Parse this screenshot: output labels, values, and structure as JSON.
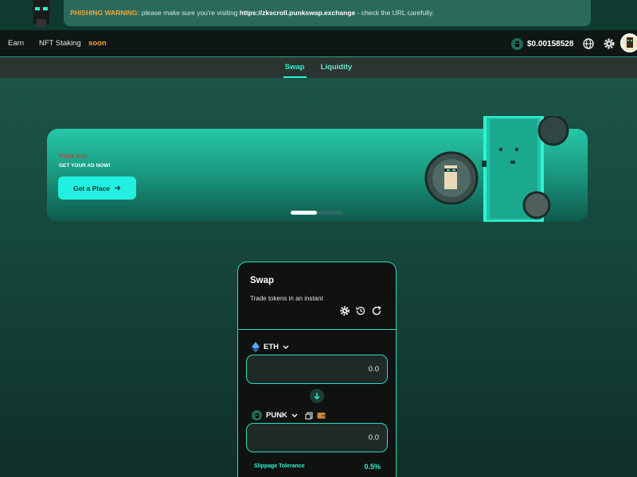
{
  "banner": {
    "warning_label": "PHISHING WARNING:",
    "message_before": " please make sure you're visiting ",
    "url": "https://zkscroll.punkswap.exchange",
    "message_after": " - check the URL carefully."
  },
  "nav": {
    "items": [
      {
        "label": "Earn"
      },
      {
        "label": "NFT Staking"
      }
    ],
    "soon_label": "soon",
    "price": "$0.00158528"
  },
  "subnav": {
    "tabs": [
      {
        "label": "Swap",
        "active": true
      },
      {
        "label": "Liquidity",
        "active": false
      }
    ]
  },
  "ad": {
    "title": "Punk Ads",
    "subtitle": "GET YOUR AD NOW!",
    "button_label": "Get a Place",
    "carousel_progress": 0.5
  },
  "swap": {
    "title": "Swap",
    "subtitle": "Trade tokens in an instant",
    "from_token": "ETH",
    "from_amount": "0.0",
    "to_token": "PUNK",
    "to_amount": "0.0",
    "slippage_label": "Slippage Tolerance",
    "slippage_value": "0.5%"
  },
  "colors": {
    "accent": "#2ef2d2",
    "warning": "#f0a53a",
    "soon": "#f3a13a",
    "card_bg": "#0f1211"
  },
  "icons": [
    "punk-mascot-icon",
    "punk-coin-icon",
    "globe-icon",
    "gear-icon",
    "settings-icon",
    "history-icon",
    "refresh-icon",
    "eth-icon",
    "chevron-down-icon",
    "arrow-down-icon",
    "copy-icon",
    "wallet-icon",
    "arrow-right-icon"
  ]
}
